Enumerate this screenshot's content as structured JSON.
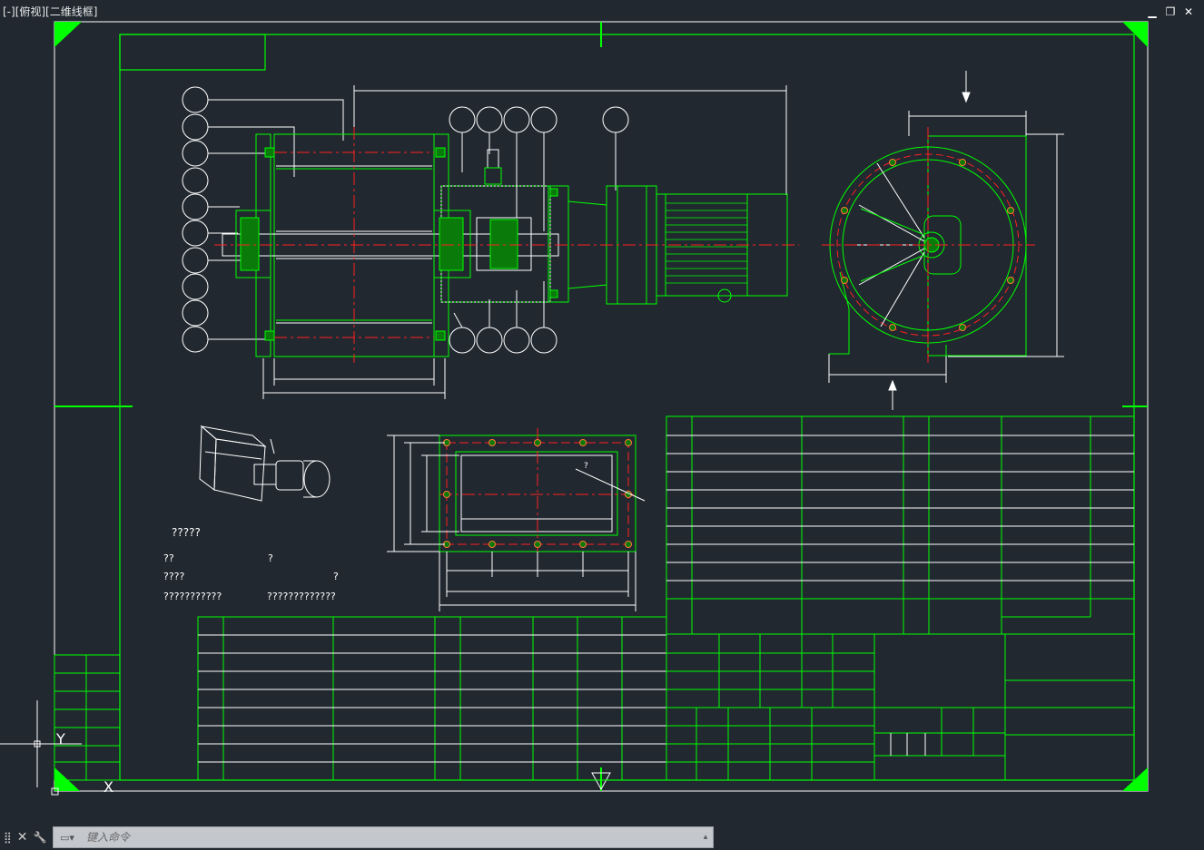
{
  "viewport": {
    "label": "[-][俯视][二维线框]"
  },
  "window_controls": {
    "minimize": "▁",
    "restore": "❐",
    "close": "✕"
  },
  "command_line": {
    "placeholder": "键入命令",
    "close_icon": "✕",
    "settings_icon": "🔧",
    "grip_icon": "⣿",
    "recent_icon": "▭▾",
    "arrow_icon": "▴"
  },
  "drawing": {
    "notes": {
      "title": "?????",
      "line1_left": "??",
      "line1_right": "?",
      "line2_left": "????",
      "line2_right": "?",
      "line3_left": "???????????",
      "line3_right": "?????????????"
    },
    "callout_mark": "?",
    "ucs": {
      "y_label": "Y",
      "x_label": "X"
    }
  },
  "colors": {
    "background": "#212830",
    "frame": "#00ff00",
    "line": "#ffffff",
    "centerline": "#ff2020",
    "hatch": "#00ff00"
  }
}
